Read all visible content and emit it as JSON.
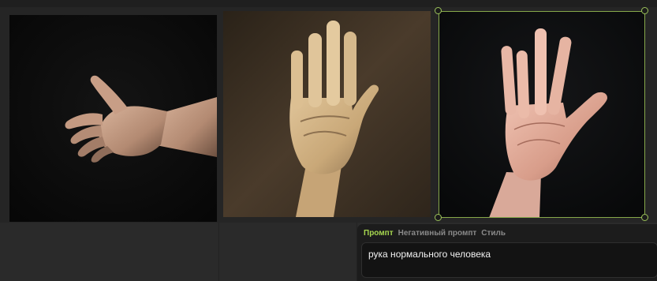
{
  "prompt_panel": {
    "tabs": [
      {
        "label": "Промпт",
        "active": true
      },
      {
        "label": "Негативный промпт",
        "active": false
      },
      {
        "label": "Стиль",
        "active": false
      }
    ],
    "prompt_text": "рука нормального человека"
  },
  "colors": {
    "accent": "#a6d64f",
    "selection_border": "#86a84a",
    "panel_bg": "#1c1c1c",
    "page_bg": "#252525"
  },
  "images": [
    {
      "subject": "hand-reaching-sideways",
      "selected": false
    },
    {
      "subject": "sculpted-raised-hand",
      "selected": false
    },
    {
      "subject": "raised-open-hand",
      "selected": true
    }
  ]
}
